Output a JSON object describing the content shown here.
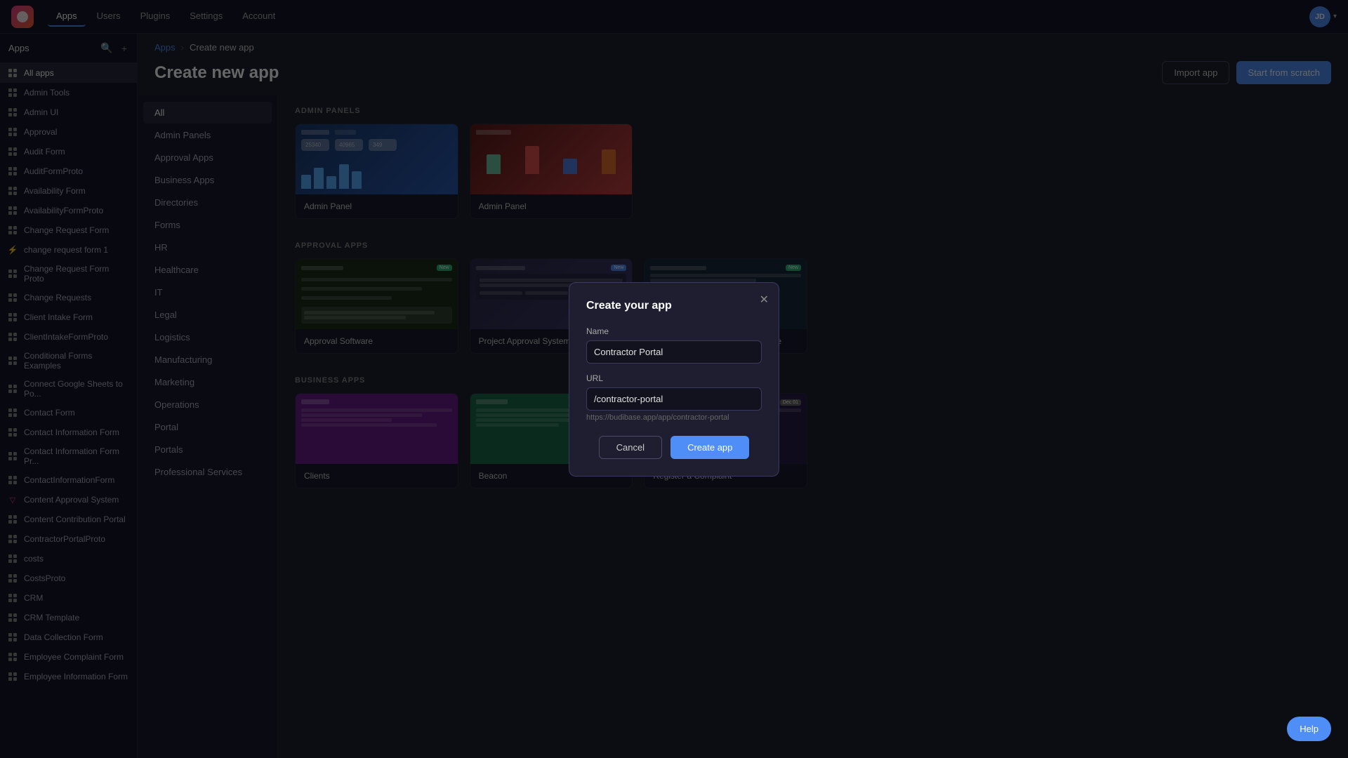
{
  "topnav": {
    "logo_alt": "Budibase logo",
    "links": [
      {
        "label": "Apps",
        "active": true
      },
      {
        "label": "Users",
        "active": false
      },
      {
        "label": "Plugins",
        "active": false
      },
      {
        "label": "Settings",
        "active": false
      },
      {
        "label": "Account",
        "active": false
      }
    ],
    "avatar_text": "JD"
  },
  "sidebar": {
    "title": "Apps",
    "search_label": "Search",
    "add_label": "Add",
    "items": [
      {
        "label": "All apps",
        "active": true,
        "icon": "grid"
      },
      {
        "label": "Admin Tools",
        "icon": "grid"
      },
      {
        "label": "Admin UI",
        "icon": "grid"
      },
      {
        "label": "Approval",
        "icon": "grid"
      },
      {
        "label": "Audit Form",
        "icon": "grid"
      },
      {
        "label": "AuditFormProto",
        "icon": "grid"
      },
      {
        "label": "Availability Form",
        "icon": "grid"
      },
      {
        "label": "AvailabilityFormProto",
        "icon": "grid"
      },
      {
        "label": "Change Request Form",
        "icon": "grid"
      },
      {
        "label": "change request form 1",
        "icon": "special"
      },
      {
        "label": "Change Request Form Proto",
        "icon": "grid"
      },
      {
        "label": "Change Requests",
        "icon": "grid"
      },
      {
        "label": "Client Intake Form",
        "icon": "grid"
      },
      {
        "label": "ClientIntakeFormProto",
        "icon": "grid"
      },
      {
        "label": "Conditional Forms Examples",
        "icon": "grid"
      },
      {
        "label": "Connect Google Sheets to Po...",
        "icon": "grid"
      },
      {
        "label": "Contact Form",
        "icon": "grid"
      },
      {
        "label": "Contact Information Form",
        "icon": "grid"
      },
      {
        "label": "Contact Information Form Pr...",
        "icon": "grid"
      },
      {
        "label": "ContactInformationForm",
        "icon": "grid"
      },
      {
        "label": "Content Approval System",
        "icon": "special2"
      },
      {
        "label": "Content Contribution Portal",
        "icon": "grid"
      },
      {
        "label": "ContractorPortalProto",
        "icon": "grid"
      },
      {
        "label": "costs",
        "icon": "grid"
      },
      {
        "label": "CostsProto",
        "icon": "grid"
      },
      {
        "label": "CRM",
        "icon": "grid"
      },
      {
        "label": "CRM Template",
        "icon": "grid"
      },
      {
        "label": "Data Collection Form",
        "icon": "grid"
      },
      {
        "label": "Employee Complaint Form",
        "icon": "grid"
      },
      {
        "label": "Employee Information Form",
        "icon": "grid"
      }
    ]
  },
  "breadcrumb": {
    "parent": "Apps",
    "separator": "›",
    "current": "Create new app"
  },
  "page": {
    "title": "Create new app",
    "import_btn": "Import app",
    "scratch_btn": "Start from scratch"
  },
  "templates_categories": [
    {
      "label": "All",
      "active": true
    },
    {
      "label": "Admin Panels"
    },
    {
      "label": "Approval Apps"
    },
    {
      "label": "Business Apps"
    },
    {
      "label": "Directories"
    },
    {
      "label": "Forms"
    },
    {
      "label": "HR"
    },
    {
      "label": "Healthcare"
    },
    {
      "label": "IT"
    },
    {
      "label": "Legal"
    },
    {
      "label": "Logistics"
    },
    {
      "label": "Manufacturing"
    },
    {
      "label": "Marketing"
    },
    {
      "label": "Operations"
    },
    {
      "label": "Portal"
    },
    {
      "label": "Portals"
    },
    {
      "label": "Professional Services"
    }
  ],
  "sections": [
    {
      "label": "ADMIN PANELS",
      "cards": [
        {
          "label": "Admin Panel",
          "preview": "admin1"
        },
        {
          "label": "Admin Panel",
          "preview": "admin2"
        }
      ]
    },
    {
      "label": "APPROVAL APPS",
      "cards": [
        {
          "label": "Approval Software",
          "preview": "approval"
        },
        {
          "label": "Project Approval System",
          "preview": "project"
        },
        {
          "label": "Travel Approval Request Template",
          "preview": "travel"
        }
      ]
    },
    {
      "label": "BUSINESS APPS",
      "cards": [
        {
          "label": "Clients",
          "preview": "clients"
        },
        {
          "label": "Beacon",
          "preview": "beacon"
        },
        {
          "label": "Register a Complaint",
          "preview": "complaint"
        }
      ]
    }
  ],
  "modal": {
    "title": "Create your app",
    "name_label": "Name",
    "name_value": "Contractor Portal",
    "url_label": "URL",
    "url_value": "/contractor-portal",
    "url_hint": "https://budibase.app/app/contractor-portal",
    "cancel_btn": "Cancel",
    "create_btn": "Create app"
  },
  "help_btn": "Help"
}
